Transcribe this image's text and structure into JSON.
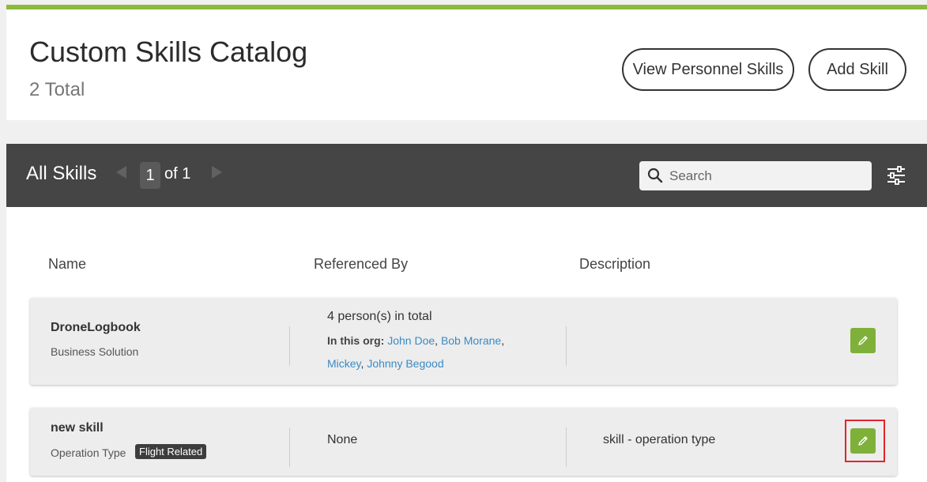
{
  "header": {
    "title": "Custom Skills Catalog",
    "total": "2 Total",
    "view_personnel_label": "View Personnel Skills",
    "add_skill_label": "Add Skill",
    "accent_color": "#8cba3c"
  },
  "toolbar": {
    "title": "All Skills",
    "current_page": "1",
    "page_of": "of 1",
    "search_placeholder": "Search",
    "search_value": "",
    "icons": [
      "chevron-left-icon",
      "chevron-right-icon",
      "search-icon",
      "filter-sliders-icon"
    ]
  },
  "table": {
    "columns": [
      "Name",
      "Referenced By",
      "Description"
    ],
    "rows": [
      {
        "name": "DroneLogbook",
        "type": "Business Solution",
        "tag": "",
        "ref_total": "4 person(s) in total",
        "ref_org_label": "In this org:",
        "ref_people": [
          "John Doe",
          "Bob Morane",
          "Mickey",
          "Johnny Begood"
        ],
        "description": ""
      },
      {
        "name": "new skill",
        "type": "Operation Type",
        "tag": "Flight Related",
        "ref_total": "None",
        "description": "skill - operation type"
      }
    ],
    "edit_icon": "pencil-icon",
    "edit_color": "#7fb03a",
    "highlight_color": "#e0262b"
  }
}
